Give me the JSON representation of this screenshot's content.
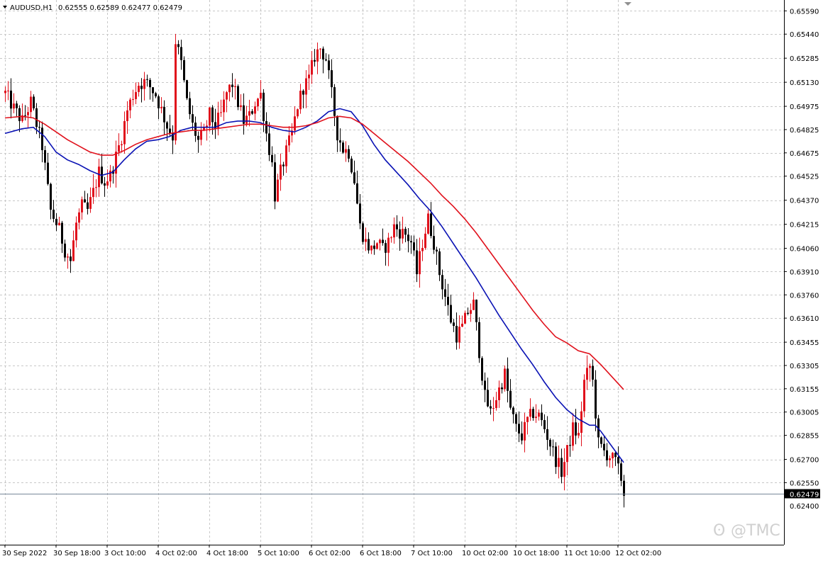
{
  "window": {
    "symbol_title": "AUDUSD,H1",
    "ohlc_text": "0.62555 0.62589 0.62477 0.62479",
    "watermark": "@TMC"
  },
  "colors": {
    "background": "#ffffff",
    "grid": "#c8c8c8",
    "bull": "#e0111c",
    "bear": "#000000",
    "ma_fast": "#0a12b4",
    "ma_slow": "#e0111c",
    "price_line": "#778899",
    "price_tag_bg": "#000000",
    "price_tag_text": "#ffffff"
  },
  "chart_data": {
    "type": "candlestick",
    "symbol": "AUDUSD",
    "timeframe": "H1",
    "current_price": 0.62479,
    "current_price_label": "0.62479",
    "ylim": [
      0.6215,
      0.6566
    ],
    "y_ticks": [
      "0.65590",
      "0.65440",
      "0.65285",
      "0.65130",
      "0.64975",
      "0.64825",
      "0.64675",
      "0.64525",
      "0.64370",
      "0.64215",
      "0.64060",
      "0.63910",
      "0.63760",
      "0.63610",
      "0.63455",
      "0.63305",
      "0.63155",
      "0.63005",
      "0.62855",
      "0.62700",
      "0.62550"
    ],
    "y_tick_values": [
      0.6559,
      0.6544,
      0.65285,
      0.6513,
      0.64975,
      0.64825,
      0.64675,
      0.64525,
      0.6437,
      0.64215,
      0.6406,
      0.6391,
      0.6376,
      0.6361,
      0.63455,
      0.63305,
      0.63155,
      0.63005,
      0.62855,
      0.627,
      0.6255
    ],
    "partial_bottom_tick": "0.62400",
    "x_ticks": [
      {
        "label": "30 Sep 2022",
        "bar": 0
      },
      {
        "label": "30 Sep 18:00",
        "bar": 18
      },
      {
        "label": "3 Oct 10:00",
        "bar": 36
      },
      {
        "label": "4 Oct 02:00",
        "bar": 54
      },
      {
        "label": "4 Oct 18:00",
        "bar": 72
      },
      {
        "label": "5 Oct 10:00",
        "bar": 90
      },
      {
        "label": "6 Oct 02:00",
        "bar": 108
      },
      {
        "label": "6 Oct 18:00",
        "bar": 126
      },
      {
        "label": "7 Oct 10:00",
        "bar": 144
      },
      {
        "label": "10 Oct 02:00",
        "bar": 162
      },
      {
        "label": "10 Oct 18:00",
        "bar": 180
      },
      {
        "label": "11 Oct 10:00",
        "bar": 198
      },
      {
        "label": "12 Oct 02:00",
        "bar": 216
      }
    ],
    "candle_anchors": [
      [
        0,
        0.6506
      ],
      [
        3,
        0.6496
      ],
      [
        6,
        0.6488
      ],
      [
        9,
        0.65
      ],
      [
        11,
        0.6486
      ],
      [
        13,
        0.6472
      ],
      [
        16,
        0.643
      ],
      [
        19,
        0.6418
      ],
      [
        21,
        0.6405
      ],
      [
        23,
        0.6398
      ],
      [
        25,
        0.6422
      ],
      [
        27,
        0.6433
      ],
      [
        29,
        0.643
      ],
      [
        31,
        0.6442
      ],
      [
        33,
        0.6455
      ],
      [
        35,
        0.6449
      ],
      [
        37,
        0.6453
      ],
      [
        39,
        0.6465
      ],
      [
        41,
        0.6478
      ],
      [
        43,
        0.6495
      ],
      [
        45,
        0.6505
      ],
      [
        47,
        0.6512
      ],
      [
        49,
        0.6513
      ],
      [
        51,
        0.651
      ],
      [
        53,
        0.6505
      ],
      [
        55,
        0.6495
      ],
      [
        57,
        0.6485
      ],
      [
        59,
        0.6478
      ],
      [
        60,
        0.654
      ],
      [
        62,
        0.6525
      ],
      [
        64,
        0.65
      ],
      [
        66,
        0.6485
      ],
      [
        68,
        0.6475
      ],
      [
        70,
        0.648
      ],
      [
        72,
        0.6492
      ],
      [
        74,
        0.6485
      ],
      [
        76,
        0.6492
      ],
      [
        78,
        0.6506
      ],
      [
        80,
        0.6512
      ],
      [
        82,
        0.65
      ],
      [
        84,
        0.6488
      ],
      [
        86,
        0.6491
      ],
      [
        88,
        0.65
      ],
      [
        90,
        0.6505
      ],
      [
        92,
        0.648
      ],
      [
        94,
        0.646
      ],
      [
        95,
        0.644
      ],
      [
        97,
        0.6455
      ],
      [
        99,
        0.6468
      ],
      [
        101,
        0.648
      ],
      [
        103,
        0.6498
      ],
      [
        105,
        0.651
      ],
      [
        107,
        0.6515
      ],
      [
        109,
        0.653
      ],
      [
        111,
        0.6535
      ],
      [
        113,
        0.6528
      ],
      [
        115,
        0.6505
      ],
      [
        117,
        0.648
      ],
      [
        119,
        0.647
      ],
      [
        121,
        0.6468
      ],
      [
        123,
        0.645
      ],
      [
        125,
        0.642
      ],
      [
        127,
        0.641
      ],
      [
        129,
        0.6405
      ],
      [
        131,
        0.641
      ],
      [
        133,
        0.6405
      ],
      [
        135,
        0.641
      ],
      [
        137,
        0.642
      ],
      [
        139,
        0.6417
      ],
      [
        141,
        0.6415
      ],
      [
        143,
        0.641
      ],
      [
        145,
        0.639
      ],
      [
        147,
        0.641
      ],
      [
        149,
        0.6425
      ],
      [
        151,
        0.641
      ],
      [
        153,
        0.639
      ],
      [
        155,
        0.6375
      ],
      [
        157,
        0.636
      ],
      [
        159,
        0.635
      ],
      [
        161,
        0.6355
      ],
      [
        163,
        0.6365
      ],
      [
        165,
        0.637
      ],
      [
        167,
        0.634
      ],
      [
        169,
        0.631
      ],
      [
        171,
        0.63
      ],
      [
        173,
        0.631
      ],
      [
        175,
        0.632
      ],
      [
        176,
        0.6325
      ],
      [
        178,
        0.6302
      ],
      [
        180,
        0.629
      ],
      [
        182,
        0.6285
      ],
      [
        184,
        0.6295
      ],
      [
        186,
        0.63
      ],
      [
        188,
        0.6298
      ],
      [
        190,
        0.629
      ],
      [
        192,
        0.628
      ],
      [
        194,
        0.627
      ],
      [
        196,
        0.6262
      ],
      [
        198,
        0.6275
      ],
      [
        200,
        0.629
      ],
      [
        202,
        0.6285
      ],
      [
        204,
        0.632
      ],
      [
        206,
        0.633
      ],
      [
        207,
        0.632
      ],
      [
        209,
        0.628
      ],
      [
        211,
        0.6275
      ],
      [
        213,
        0.6272
      ],
      [
        215,
        0.6268
      ],
      [
        217,
        0.6258
      ],
      [
        218,
        0.6248
      ]
    ],
    "series": [
      {
        "name": "",
        "color": "#0a12b4",
        "points": [
          [
            0,
            0.648
          ],
          [
            6,
            0.6483
          ],
          [
            10,
            0.6484
          ],
          [
            14,
            0.6478
          ],
          [
            18,
            0.6468
          ],
          [
            22,
            0.6463
          ],
          [
            26,
            0.646
          ],
          [
            30,
            0.6456
          ],
          [
            34,
            0.6453
          ],
          [
            38,
            0.6455
          ],
          [
            42,
            0.6463
          ],
          [
            46,
            0.647
          ],
          [
            50,
            0.6475
          ],
          [
            54,
            0.6476
          ],
          [
            58,
            0.6478
          ],
          [
            62,
            0.6482
          ],
          [
            66,
            0.6484
          ],
          [
            70,
            0.6484
          ],
          [
            74,
            0.6484
          ],
          [
            78,
            0.6487
          ],
          [
            82,
            0.6488
          ],
          [
            86,
            0.6488
          ],
          [
            90,
            0.6487
          ],
          [
            94,
            0.6484
          ],
          [
            98,
            0.6482
          ],
          [
            102,
            0.6481
          ],
          [
            106,
            0.6484
          ],
          [
            110,
            0.6488
          ],
          [
            114,
            0.6494
          ],
          [
            118,
            0.6496
          ],
          [
            122,
            0.6494
          ],
          [
            126,
            0.6485
          ],
          [
            130,
            0.6473
          ],
          [
            134,
            0.6463
          ],
          [
            138,
            0.6455
          ],
          [
            142,
            0.6447
          ],
          [
            146,
            0.6438
          ],
          [
            150,
            0.643
          ],
          [
            154,
            0.642
          ],
          [
            158,
            0.6409
          ],
          [
            162,
            0.6398
          ],
          [
            166,
            0.6387
          ],
          [
            170,
            0.6375
          ],
          [
            174,
            0.6363
          ],
          [
            178,
            0.6352
          ],
          [
            182,
            0.6341
          ],
          [
            186,
            0.6331
          ],
          [
            190,
            0.632
          ],
          [
            194,
            0.631
          ],
          [
            198,
            0.6302
          ],
          [
            202,
            0.6296
          ],
          [
            206,
            0.6292
          ],
          [
            208,
            0.6292
          ],
          [
            210,
            0.6288
          ],
          [
            214,
            0.6278
          ],
          [
            218,
            0.6268
          ]
        ]
      },
      {
        "name": "",
        "color": "#e0111c",
        "points": [
          [
            0,
            0.649
          ],
          [
            6,
            0.6491
          ],
          [
            10,
            0.649
          ],
          [
            14,
            0.6486
          ],
          [
            18,
            0.6481
          ],
          [
            22,
            0.6476
          ],
          [
            26,
            0.6472
          ],
          [
            30,
            0.6468
          ],
          [
            34,
            0.6466
          ],
          [
            38,
            0.6466
          ],
          [
            42,
            0.6469
          ],
          [
            46,
            0.6473
          ],
          [
            50,
            0.6476
          ],
          [
            54,
            0.6478
          ],
          [
            58,
            0.648
          ],
          [
            62,
            0.6481
          ],
          [
            66,
            0.6482
          ],
          [
            70,
            0.6482
          ],
          [
            74,
            0.6483
          ],
          [
            78,
            0.6484
          ],
          [
            82,
            0.6485
          ],
          [
            86,
            0.6486
          ],
          [
            90,
            0.6486
          ],
          [
            94,
            0.6485
          ],
          [
            98,
            0.6484
          ],
          [
            102,
            0.6484
          ],
          [
            106,
            0.6485
          ],
          [
            110,
            0.6487
          ],
          [
            114,
            0.649
          ],
          [
            118,
            0.6491
          ],
          [
            122,
            0.649
          ],
          [
            126,
            0.6486
          ],
          [
            130,
            0.648
          ],
          [
            134,
            0.6474
          ],
          [
            138,
            0.6468
          ],
          [
            142,
            0.6462
          ],
          [
            146,
            0.6455
          ],
          [
            150,
            0.6448
          ],
          [
            154,
            0.644
          ],
          [
            158,
            0.6433
          ],
          [
            162,
            0.6425
          ],
          [
            166,
            0.6416
          ],
          [
            170,
            0.6406
          ],
          [
            174,
            0.6396
          ],
          [
            178,
            0.6386
          ],
          [
            182,
            0.6376
          ],
          [
            186,
            0.6366
          ],
          [
            190,
            0.6357
          ],
          [
            194,
            0.6349
          ],
          [
            198,
            0.6345
          ],
          [
            202,
            0.634
          ],
          [
            204,
            0.6339
          ],
          [
            206,
            0.6338
          ],
          [
            210,
            0.6331
          ],
          [
            214,
            0.6323
          ],
          [
            218,
            0.6315
          ]
        ]
      }
    ],
    "grid": true,
    "bars_total": 219,
    "candle_ranges_note": ""
  }
}
